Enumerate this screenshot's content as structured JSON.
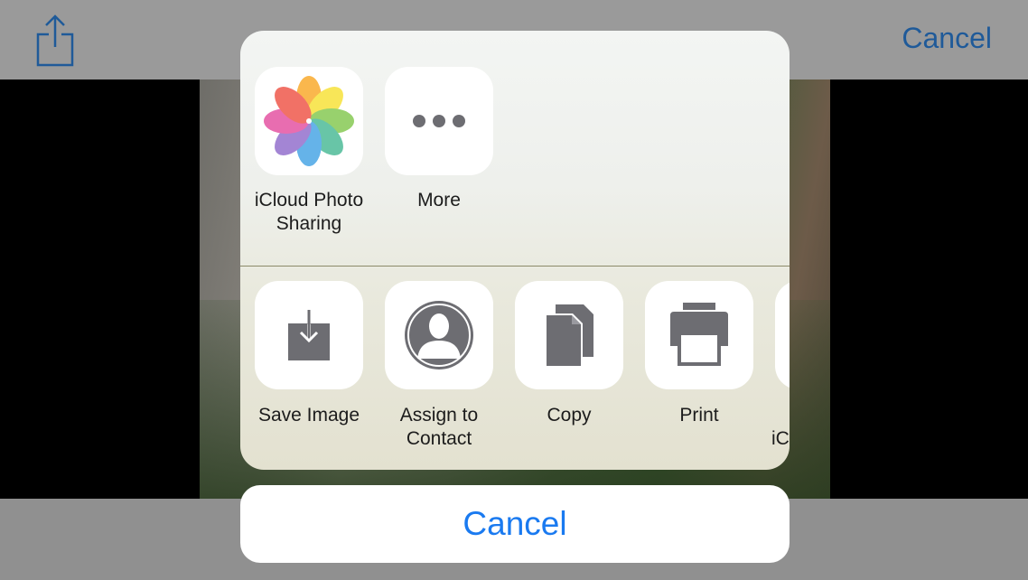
{
  "nav": {
    "share_icon": "share-icon",
    "cancel_label": "Cancel"
  },
  "share_sheet": {
    "apps": [
      {
        "label": "iCloud Photo\nSharing",
        "icon": "photos-icon"
      },
      {
        "label": "More",
        "icon": "more-icon"
      }
    ],
    "actions": [
      {
        "label": "Save Image",
        "icon": "save-image-icon"
      },
      {
        "label": "Assign to\nContact",
        "icon": "contact-icon"
      },
      {
        "label": "Copy",
        "icon": "copy-icon"
      },
      {
        "label": "Print",
        "icon": "print-icon"
      },
      {
        "label": "iC",
        "icon": "partial-action-icon"
      }
    ],
    "cancel_label": "Cancel"
  },
  "colors": {
    "ios_blue": "#1a7af0",
    "dimmed_blue": "#1f5a99",
    "icon_gray": "#6d6d72"
  }
}
